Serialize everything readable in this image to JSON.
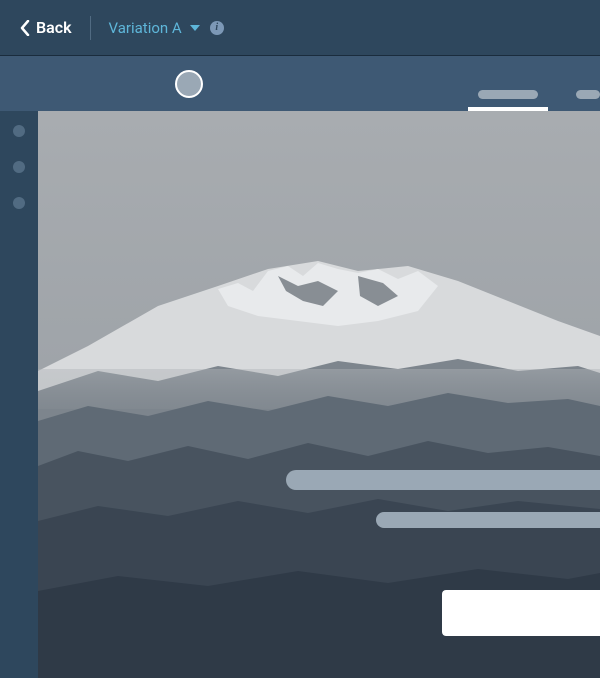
{
  "header": {
    "back_label": "Back",
    "variation_label": "Variation A",
    "info_symbol": "i"
  },
  "colors": {
    "header_bg": "#2e475d",
    "subbar_bg": "#3e5974",
    "accent": "#5eb6d9",
    "placeholder": "#9aa8b5"
  }
}
